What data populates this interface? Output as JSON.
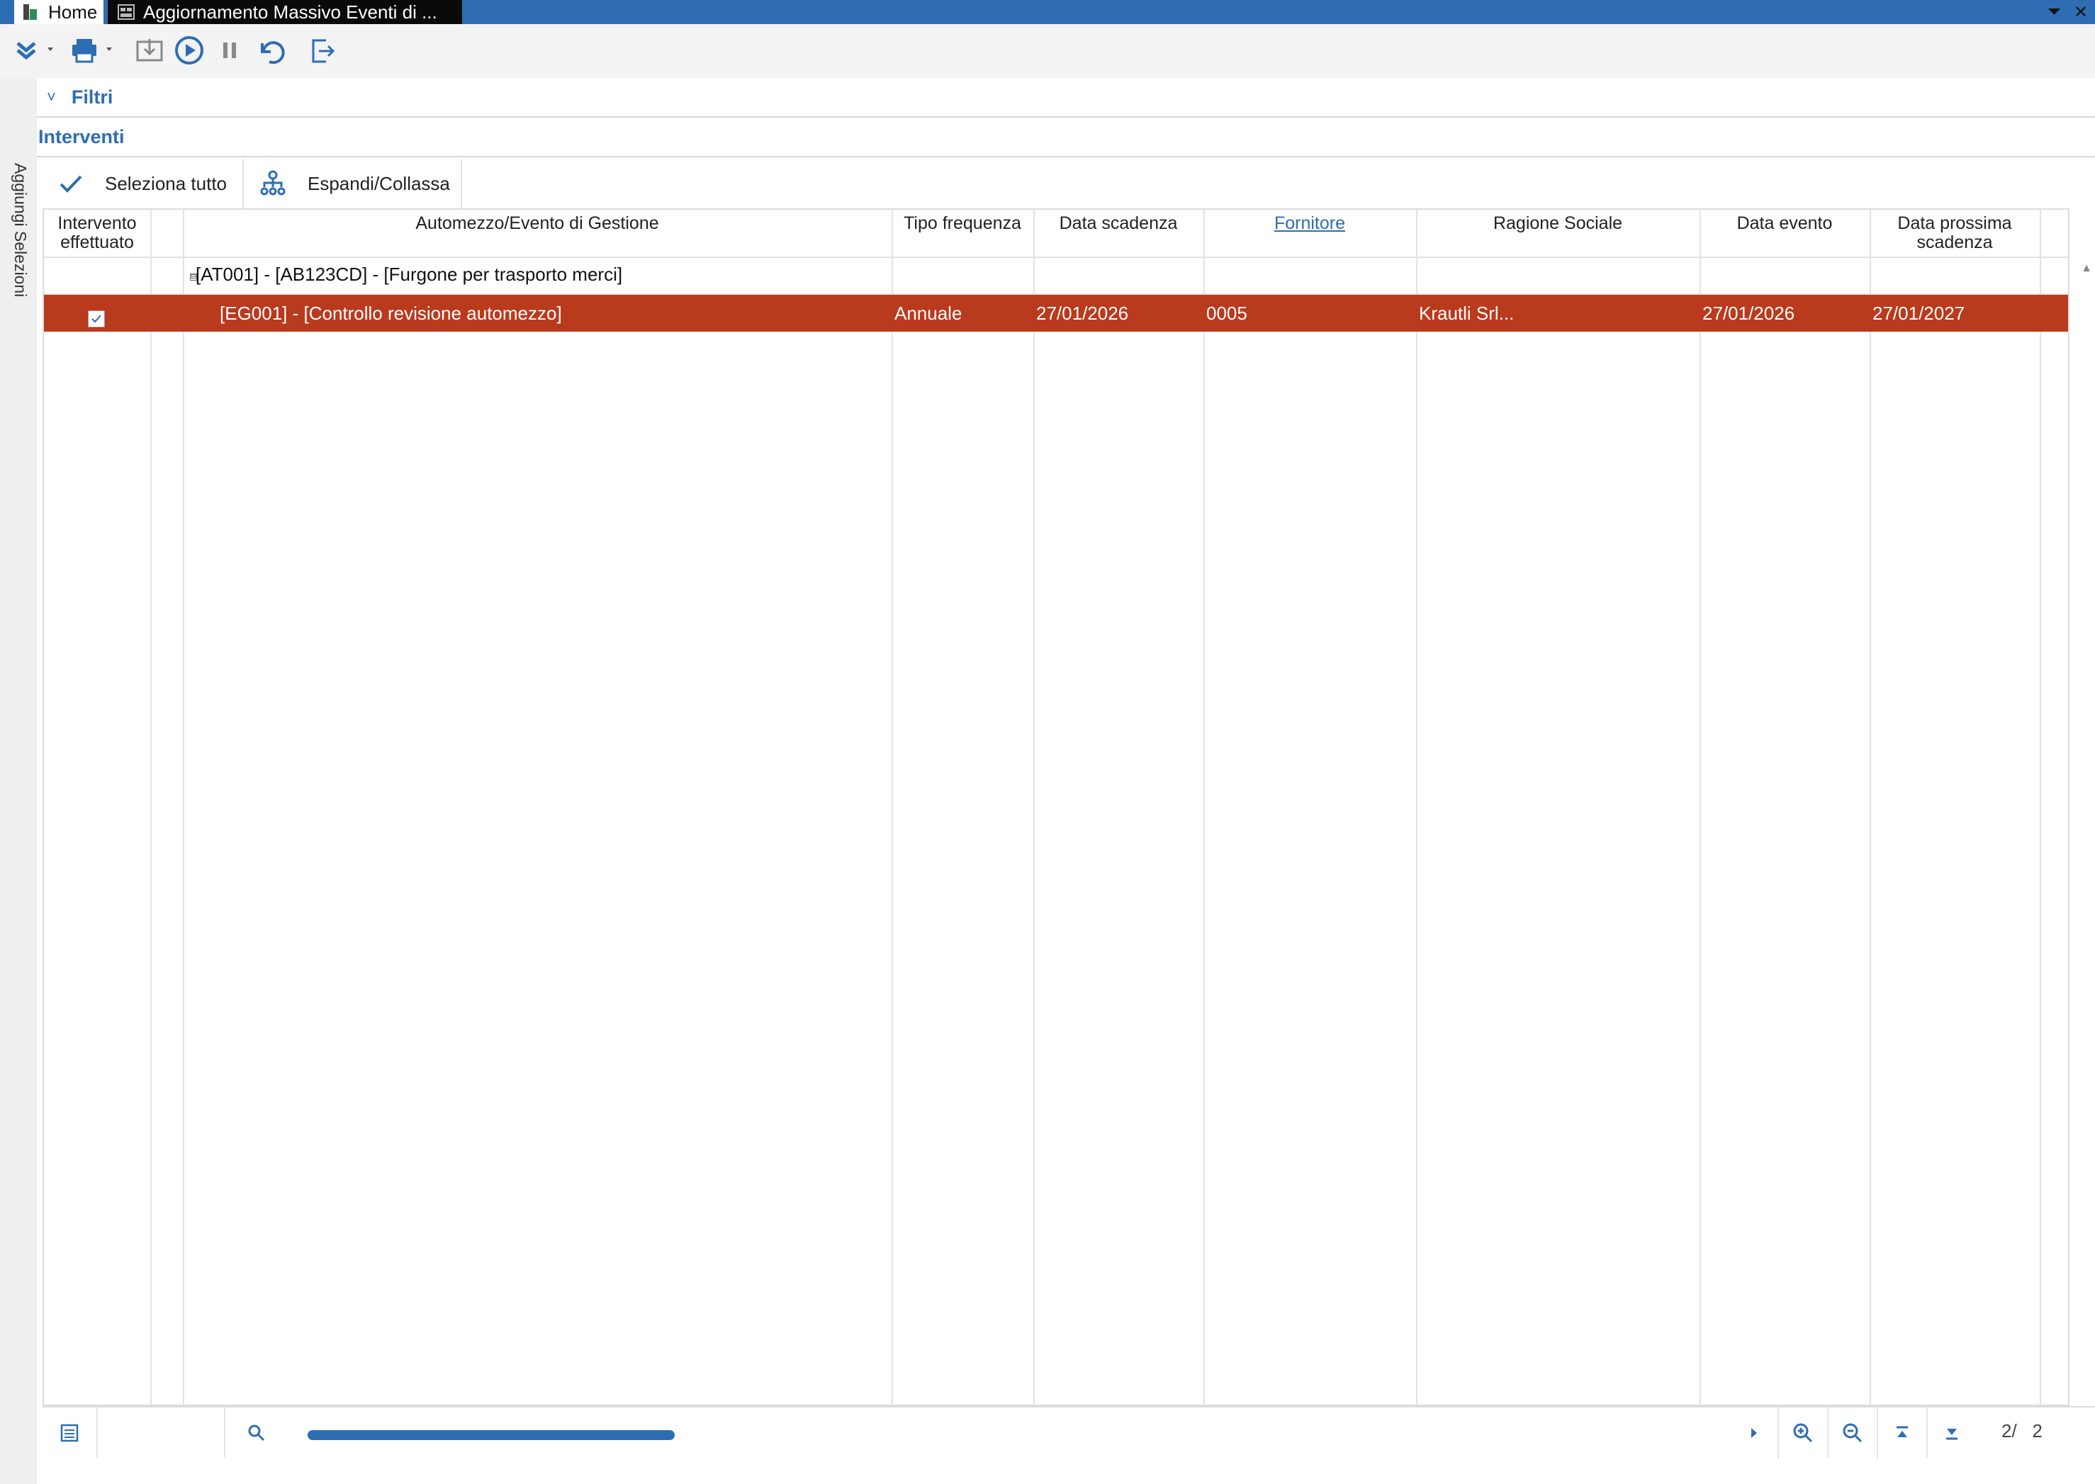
{
  "window": {
    "tabs": [
      {
        "label": "Home"
      },
      {
        "label": "Aggiornamento Massivo Eventi di ..."
      }
    ]
  },
  "colors": {
    "accent": "#2e6db4",
    "selected_row": "#b93a1d",
    "title_bar": "#2e6db4"
  },
  "toolbar": {
    "icons": [
      "double-chevron-down-icon",
      "printer-icon",
      "import-icon",
      "play-icon",
      "pause-icon",
      "undo-icon",
      "exit-icon"
    ]
  },
  "sidebar": {
    "label": "Aggiungi Selezioni"
  },
  "sections": {
    "filters_label": "Filtri",
    "interventions_label": "Interventi"
  },
  "grid_tools": {
    "select_all": "Seleziona tutto",
    "expand_collapse": "Espandi/Collassa"
  },
  "grid": {
    "columns": [
      "Intervento effettuato",
      "",
      "Automezzo/Evento di Gestione",
      "Tipo frequenza",
      "Data scadenza",
      "Fornitore",
      "Ragione Sociale",
      "Data evento",
      "Data prossima scadenza"
    ],
    "group": {
      "label": "[AT001] - [AB123CD] - [Furgone per trasporto merci]",
      "toggle": "⊟"
    },
    "rows": [
      {
        "checked": true,
        "event": "[EG001] - [Controllo revisione automezzo]",
        "frequency": "Annuale",
        "due_date": "27/01/2026",
        "supplier": "0005",
        "company_name": "Krautli Srl...",
        "event_date": "27/01/2026",
        "next_due_date": "27/01/2027"
      }
    ]
  },
  "footer": {
    "pager": "2/   2",
    "icons": [
      "list-icon",
      "search-icon",
      "scroll-right-icon",
      "zoom-in-icon",
      "zoom-out-icon",
      "first-page-icon",
      "last-page-icon"
    ]
  }
}
